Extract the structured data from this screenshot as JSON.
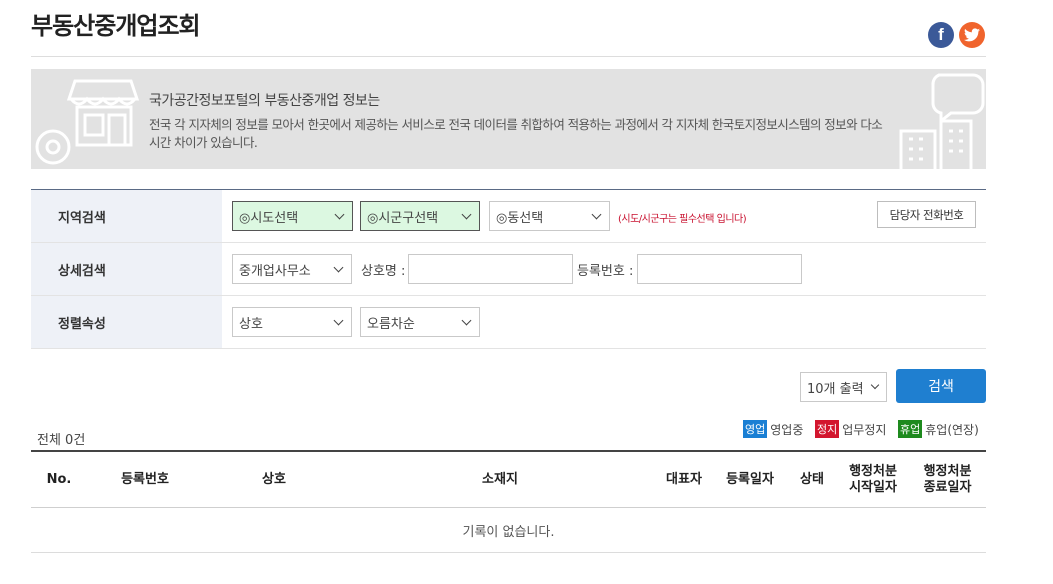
{
  "page": {
    "title": "부동산중개업조회",
    "social": [
      {
        "name": "facebook",
        "glyph": "f",
        "color": "#3b5998"
      },
      {
        "name": "twitter",
        "glyph": "t",
        "color": "#f0642d"
      }
    ]
  },
  "banner": {
    "title": "국가공간정보포털의 부동산중개업 정보는",
    "description": "전국 각 지자체의 정보를 모아서 한곳에서 제공하는 서비스로 전국 데이터를 취합하여 적용하는 과정에서 각 지자체 한국토지정보시스템의 정보와 다소 시간 차이가 있습니다."
  },
  "search": {
    "region": {
      "label": "지역검색",
      "sido": "◎시도선택",
      "sigungu": "◎시군구선택",
      "dong": "◎동선택",
      "required_note": "(시도/시군구는 필수선택 입니다)",
      "contact_button": "담당자 전화번호"
    },
    "detail": {
      "label": "상세검색",
      "type_select": "중개업사무소",
      "name_label": "상호명 :",
      "name_value": "",
      "reg_label": "등록번호 :",
      "reg_value": ""
    },
    "sort": {
      "label": "정렬속성",
      "field": "상호",
      "order": "오름차순"
    }
  },
  "controls": {
    "per_page": "10개 출력",
    "search_button": "검색"
  },
  "results": {
    "total": "전체 0건",
    "legend": [
      {
        "badge": "영업",
        "text": "영업중",
        "color": "#1a7fd4"
      },
      {
        "badge": "정지",
        "text": "업무정지",
        "color": "#d3162e"
      },
      {
        "badge": "휴업",
        "text": "휴업(연장)",
        "color": "#1e8a1e"
      }
    ],
    "columns": [
      "No.",
      "등록번호",
      "상호",
      "소재지",
      "대표자",
      "등록일자",
      "상태",
      "행정처분\n시작일자",
      "행정처분\n종료일자"
    ],
    "empty_message": "기록이 없습니다."
  }
}
